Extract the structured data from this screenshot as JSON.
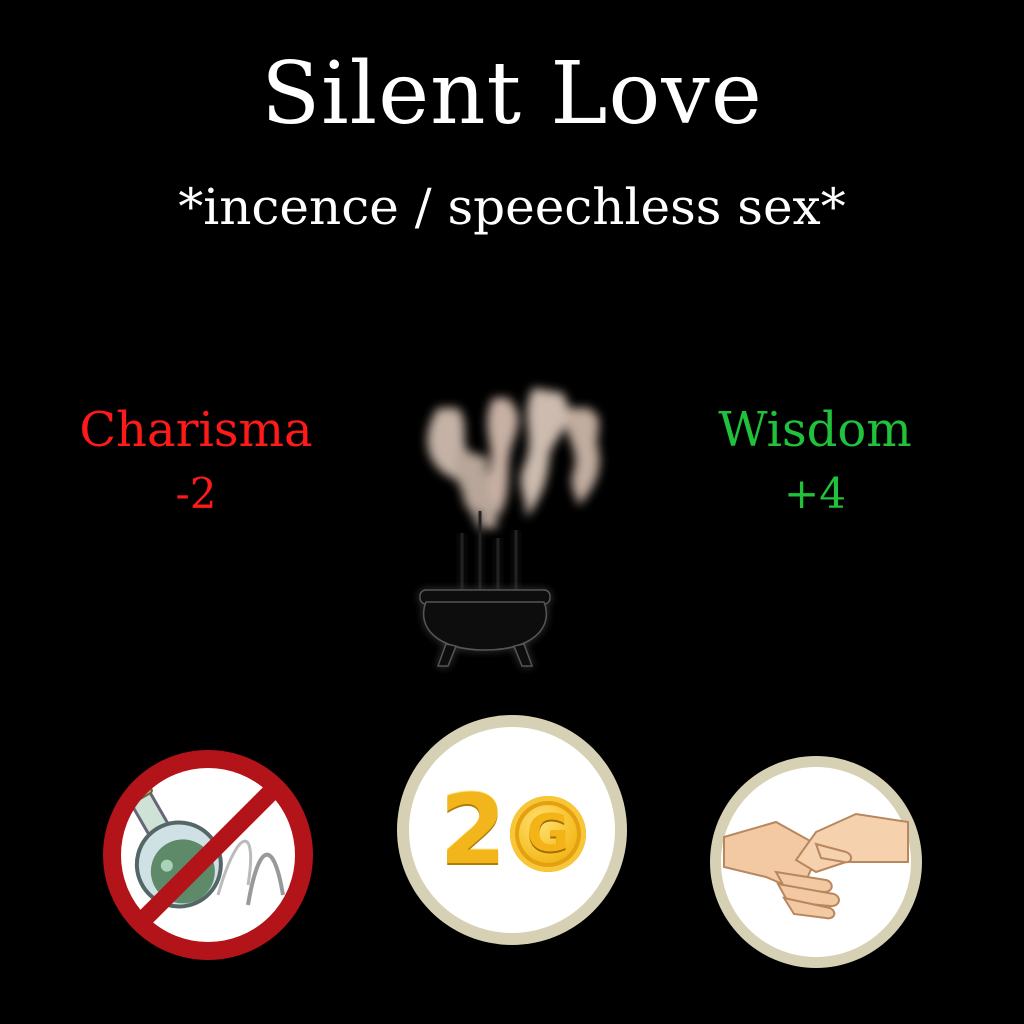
{
  "card": {
    "title": "Silent Love",
    "subtitle": "*incence / speechless sex*",
    "stat_left": {
      "name": "Charisma",
      "value": "-2",
      "color": "#ff1a1a"
    },
    "stat_right": {
      "name": "Wisdom",
      "value": "+4",
      "color": "#1fc23a"
    },
    "center_icon": "incense-cauldron-icon",
    "badges": [
      {
        "icon": "no-potion-icon"
      },
      {
        "icon": "gold-coin-icon",
        "cost": "2",
        "currency": "G"
      },
      {
        "icon": "handshake-icon"
      }
    ]
  }
}
